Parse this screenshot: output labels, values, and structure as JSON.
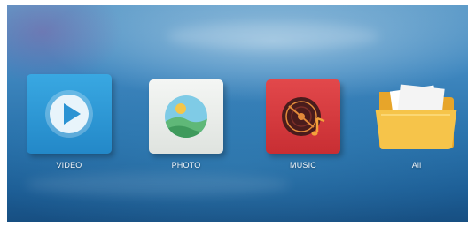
{
  "home_menu": {
    "items": [
      {
        "label": "VIDEO",
        "icon": "play-icon",
        "color": "#2f9fdc"
      },
      {
        "label": "PHOTO",
        "icon": "landscape-photo-icon",
        "color": "#eef1ee"
      },
      {
        "label": "MUSIC",
        "icon": "vinyl-note-icon",
        "color": "#d63a3e"
      },
      {
        "label": "All",
        "icon": "folder-icon",
        "color": "#f3bf3f"
      }
    ]
  }
}
